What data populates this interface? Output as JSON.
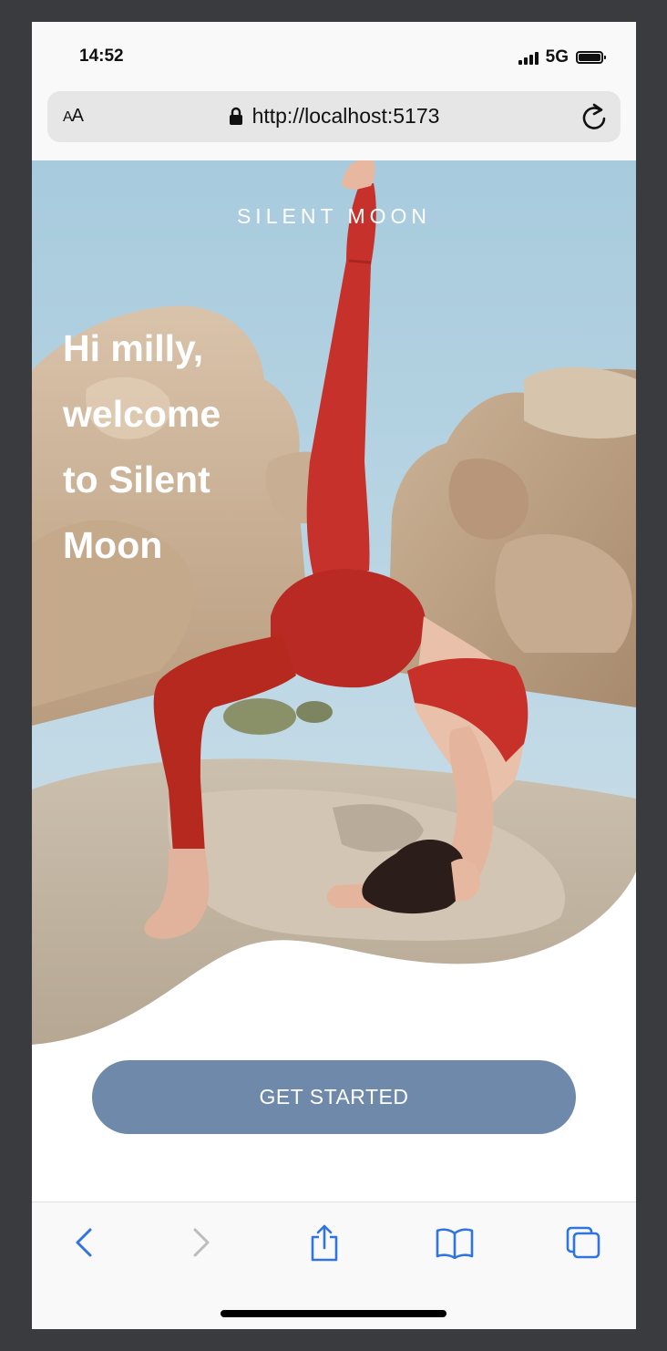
{
  "status_bar": {
    "time": "14:52",
    "network": "5G"
  },
  "browser": {
    "text_size_label_small": "A",
    "text_size_label_large": "A",
    "url": "http://localhost:5173"
  },
  "hero": {
    "brand": "SILENT  MOON",
    "greeting_lines": [
      "Hi milly,",
      "welcome",
      "to Silent",
      "Moon"
    ]
  },
  "cta": {
    "label": "GET STARTED"
  },
  "colors": {
    "cta": "#6f89aa",
    "toolbar_active": "#2f74e0",
    "toolbar_disabled": "#bcbcbc"
  },
  "toolbar_icons": [
    "back-icon",
    "forward-icon",
    "share-icon",
    "bookmarks-icon",
    "tabs-icon"
  ]
}
